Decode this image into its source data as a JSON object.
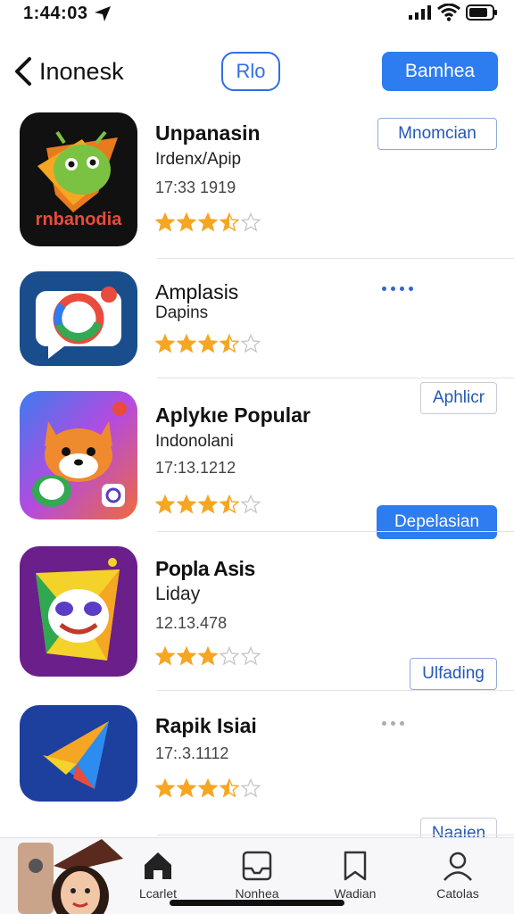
{
  "status_bar": {
    "time": "1:44:03"
  },
  "nav": {
    "back_label": "Inonesk",
    "segment_label": "Rlo",
    "primary_label": "Bamhea"
  },
  "apps": [
    {
      "title": "Unpanasin",
      "subtitle": "Irdenx/Apip",
      "meta": "17:33 1919",
      "rating": 3.5,
      "action": "Mnomcian",
      "action_style": "outline",
      "icon": "android-game-icon",
      "icon_text": "rnbanodia"
    },
    {
      "title": "Amplasis",
      "subtitle": "Dapins",
      "meta": "",
      "rating": 3.5,
      "action": "Aphlicr",
      "action_style": "outline-gray",
      "icon": "chat-ring-icon"
    },
    {
      "title": "Aplykıe Popular",
      "subtitle": "Indonolani",
      "meta": "17:13.1212",
      "rating": 3.5,
      "action": "Depelasian",
      "action_style": "fill",
      "icon": "fox-mascot-icon"
    },
    {
      "title": "Popla Asis",
      "subtitle": "Liday",
      "meta": "12.13.478",
      "rating": 3,
      "action": "Ulfading",
      "action_style": "outline",
      "icon": "clown-face-icon"
    },
    {
      "title": "Rapik Isiai",
      "subtitle": "",
      "meta": "17:.3.1112",
      "rating": 3.5,
      "action": "Naaien",
      "action_style": "outline-gray",
      "icon": "paper-plane-icon"
    }
  ],
  "tabs": [
    {
      "label": "Lcarlet",
      "icon": "home-icon"
    },
    {
      "label": "Nonhea",
      "icon": "inbox-icon"
    },
    {
      "label": "Wadian",
      "icon": "bookmark-icon"
    },
    {
      "label": "Catolas",
      "icon": "person-icon"
    }
  ],
  "colors": {
    "accent": "#2d7cf0",
    "star": "#f5a623",
    "star_empty": "#c8c8cc"
  }
}
